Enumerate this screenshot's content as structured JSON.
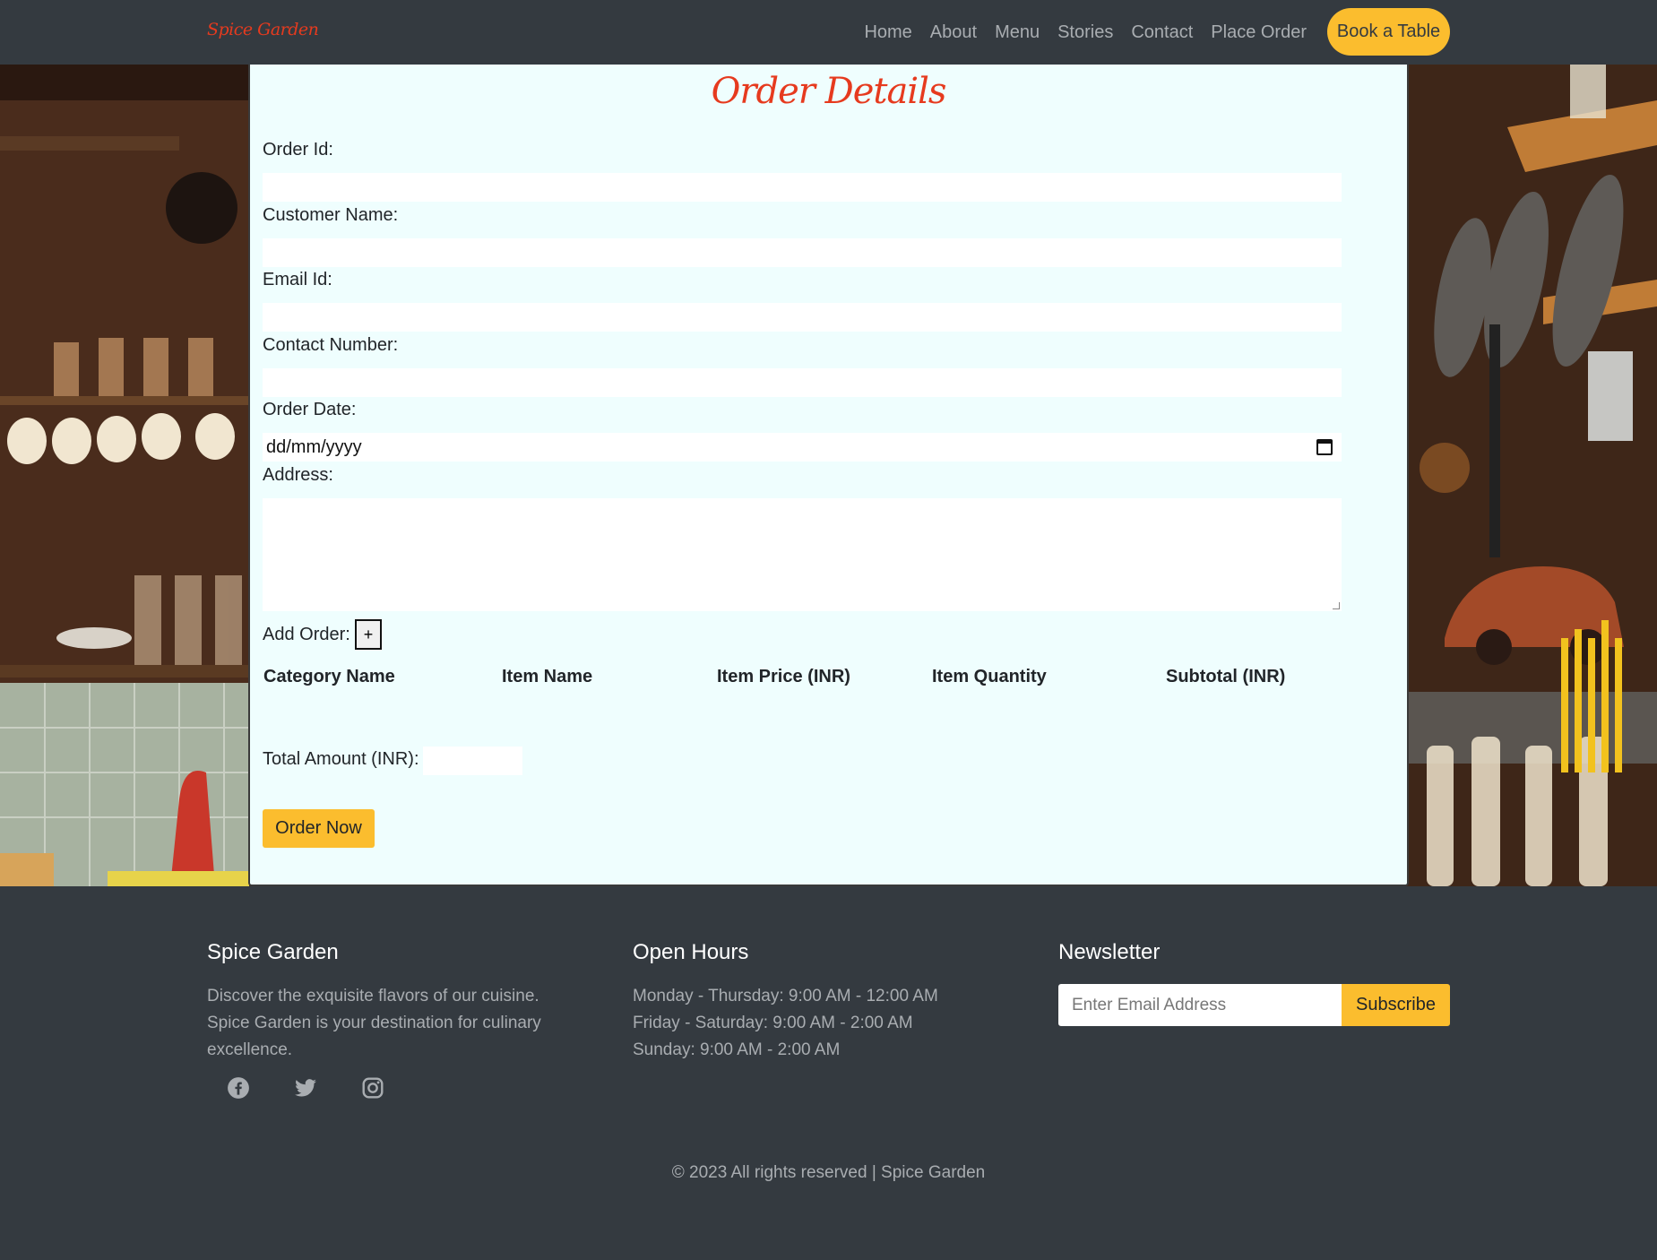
{
  "nav": {
    "brand": "Spice Garden",
    "links": [
      "Home",
      "About",
      "Menu",
      "Stories",
      "Contact",
      "Place Order"
    ],
    "cta": "Book a Table"
  },
  "form": {
    "title": "Order Details",
    "order_id_label": "Order Id:",
    "customer_name_label": "Customer Name:",
    "email_label": "Email Id:",
    "contact_label": "Contact Number:",
    "order_date_label": "Order Date:",
    "order_date_placeholder": "dd/mm/yyyy",
    "address_label": "Address:",
    "add_order_label": "Add Order:",
    "add_button": "+",
    "table_headers": [
      "Category Name",
      "Item Name",
      "Item Price (INR)",
      "Item Quantity",
      "Subtotal (INR)"
    ],
    "total_label": "Total Amount (INR):",
    "submit": "Order Now"
  },
  "footer": {
    "about_title": "Spice Garden",
    "about_text": "Discover the exquisite flavors of our cuisine. Spice Garden is your destination for culinary excellence.",
    "about_lines": [
      "Discover the exquisite flavors of our cuisine.",
      "Spice Garden is your destination for culinary",
      "excellence."
    ],
    "hours_title": "Open Hours",
    "hours": [
      "Monday - Thursday: 9:00 AM - 12:00 AM",
      "Friday - Saturday: 9:00 AM - 2:00 AM",
      "Sunday: 9:00 AM - 2:00 AM"
    ],
    "newsletter_title": "Newsletter",
    "email_placeholder": "Enter Email Address",
    "subscribe": "Subscribe",
    "social": [
      "facebook-icon",
      "twitter-icon",
      "instagram-icon"
    ],
    "copyright": "© 2023 All rights reserved | Spice Garden"
  },
  "colors": {
    "accent": "#fbbd2e",
    "brand_red": "#e63a1e",
    "dark": "#343a40",
    "form_bg": "#effefe"
  }
}
